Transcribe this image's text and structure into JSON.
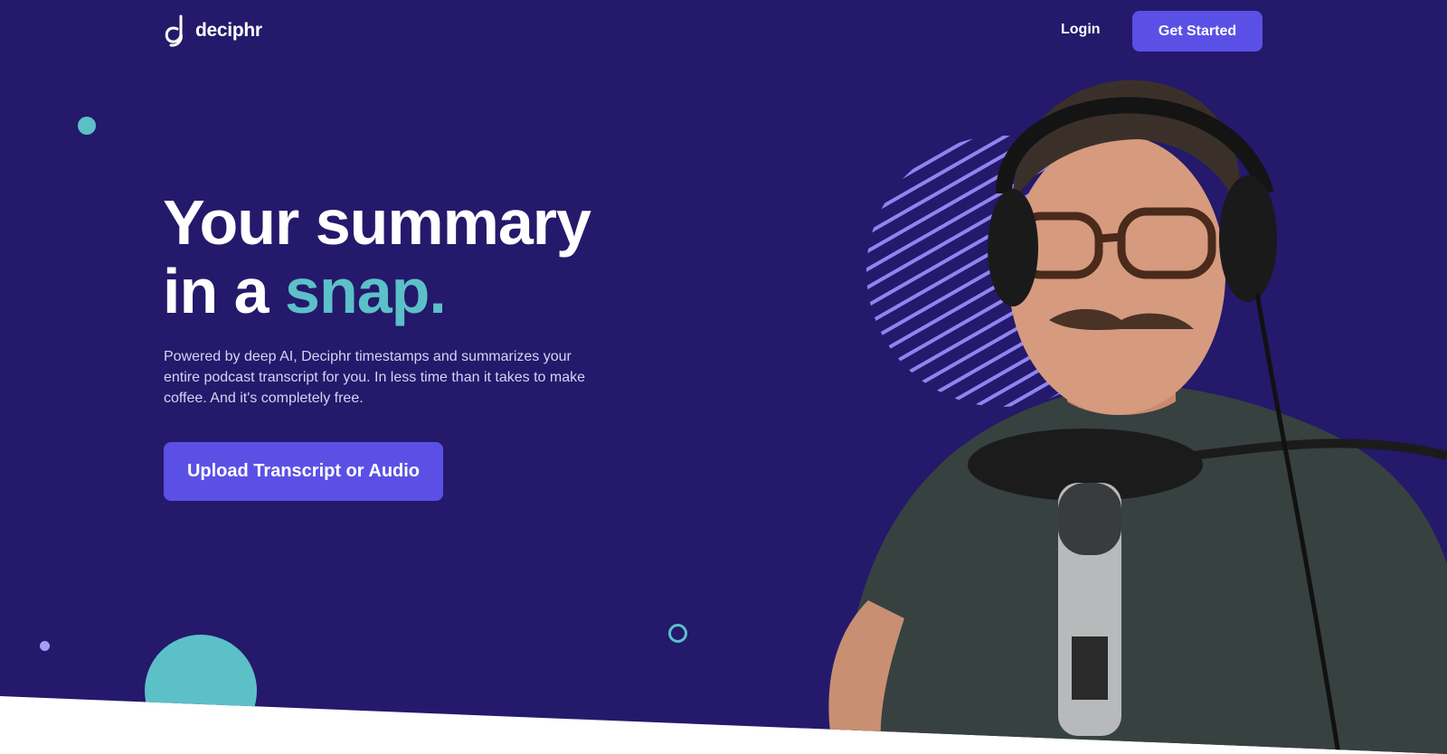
{
  "brand": {
    "name": "deciphr"
  },
  "nav": {
    "login_label": "Login",
    "cta_label": "Get Started"
  },
  "hero": {
    "headline_line1": "Your summary",
    "headline_line2_prefix": "in a ",
    "headline_accent": "snap.",
    "description": "Powered by deep AI, Deciphr timestamps and summarizes your entire podcast transcript for you. In less time than it takes to make coffee. And it's completely free.",
    "upload_label": "Upload Transcript or Audio"
  },
  "colors": {
    "background": "#24196b",
    "accent_teal": "#5cc0c9",
    "button_purple": "#5b50e6",
    "stripe_lavender": "#8f85f0"
  },
  "icons": [
    "deciphr-logo-icon"
  ]
}
